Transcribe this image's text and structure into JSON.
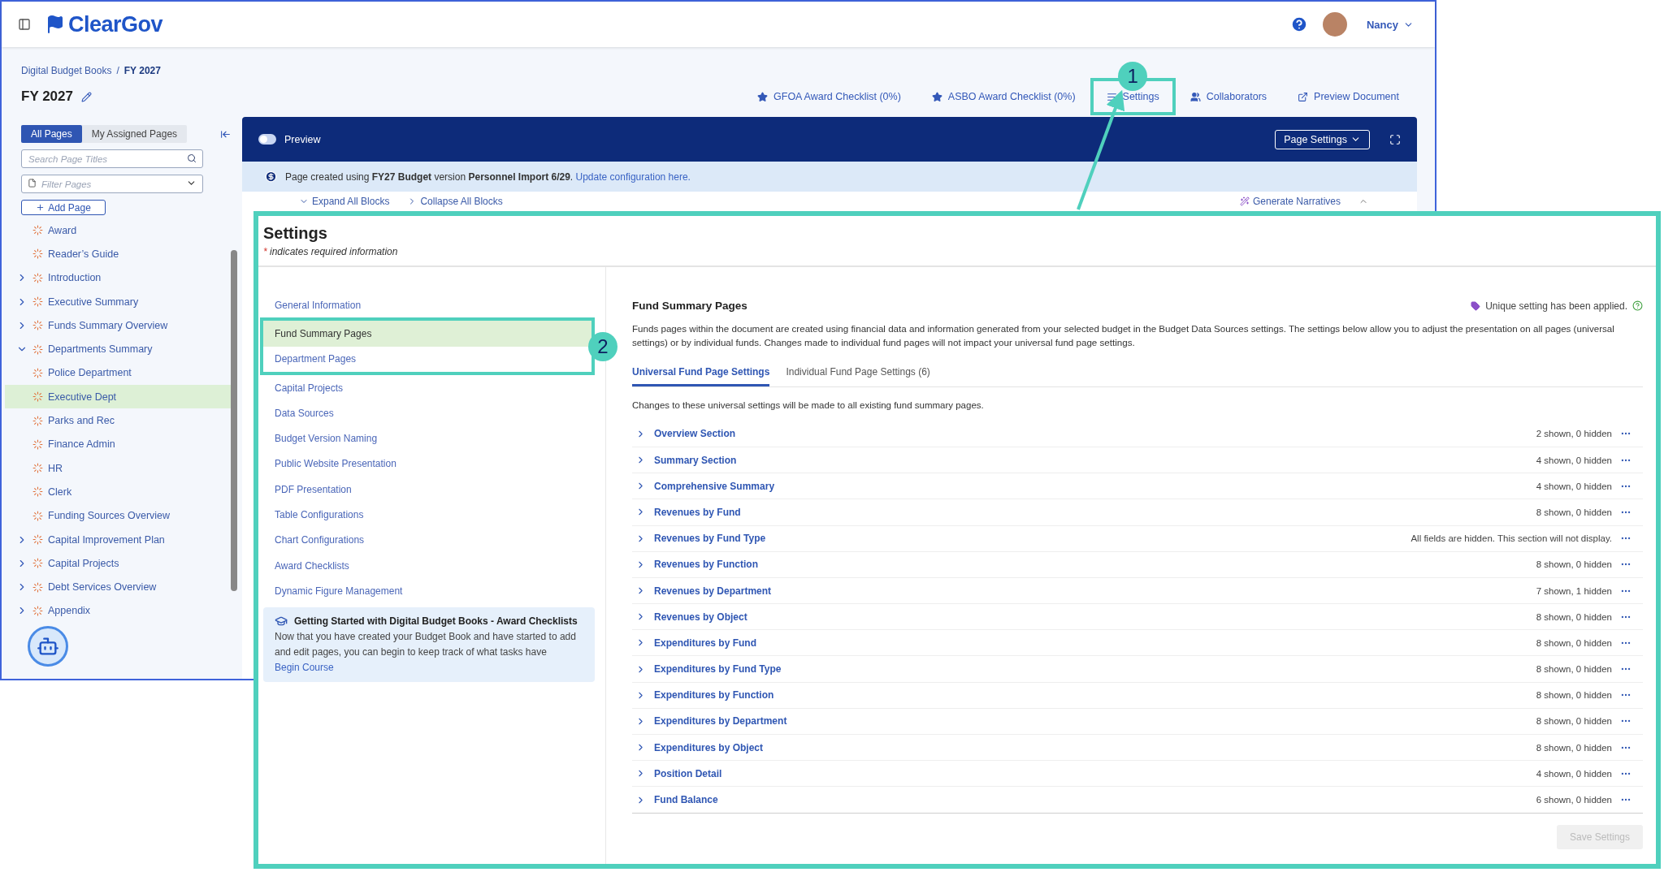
{
  "app": {
    "logo": "ClearGov",
    "user": {
      "name": "Nancy"
    },
    "breadcrumb": [
      "Digital Budget Books",
      "FY 2027"
    ],
    "breadcrumb_separator": "/",
    "title": "FY 2027",
    "actions": [
      {
        "label": "GFOA Award Checklist (0%)",
        "kind": "star"
      },
      {
        "label": "ASBO Award Checklist (0%)",
        "kind": "star"
      },
      {
        "label": "Settings",
        "kind": "settings",
        "highlighted": true
      },
      {
        "label": "Collaborators",
        "kind": "people"
      },
      {
        "label": "Preview Document",
        "kind": "external"
      }
    ],
    "sidebar": {
      "tabs": [
        {
          "label": "All Pages",
          "selected": true
        },
        {
          "label": "My Assigned Pages",
          "selected": false
        }
      ],
      "search": {
        "placeholder": "Search Page Titles"
      },
      "filter": {
        "placeholder": "Filter Pages"
      },
      "add_button": "Add Page",
      "pages": [
        {
          "label": "Award",
          "selected": false
        },
        {
          "label": "Reader’s Guide",
          "selected": false
        },
        {
          "label": "Introduction",
          "selected": false,
          "expanded": false
        },
        {
          "label": "Executive Summary",
          "selected": false,
          "expanded": false
        },
        {
          "label": "Funds Summary Overview",
          "selected": false,
          "expanded": false
        },
        {
          "label": "Departments Summary",
          "selected": false,
          "expanded": true,
          "children": [
            {
              "label": "Police Department",
              "selected": false
            },
            {
              "label": "Executive Dept",
              "selected": true
            },
            {
              "label": "Parks and Rec",
              "selected": false
            },
            {
              "label": "Finance Admin",
              "selected": false
            },
            {
              "label": "HR",
              "selected": false
            },
            {
              "label": "Clerk",
              "selected": false
            }
          ]
        },
        {
          "label": "Funding Sources Overview",
          "selected": false
        },
        {
          "label": "Capital Improvement Plan",
          "selected": false,
          "expanded": false
        },
        {
          "label": "Capital Projects",
          "selected": false,
          "expanded": false
        },
        {
          "label": "Debt Services Overview",
          "selected": false,
          "expanded": false
        },
        {
          "label": "Appendix",
          "selected": false,
          "expanded": false
        }
      ]
    },
    "editor": {
      "preview": {
        "label": "Preview",
        "on": false
      },
      "page_settings": "Page Settings",
      "info": "Page created using **FY27 Budget** version **Personnel Import 6/29**.",
      "info_link": "Update configuration here.",
      "toolbar": [
        "Expand All Blocks",
        "Collapse All Blocks",
        "Generate Narratives"
      ]
    }
  },
  "settings": {
    "title": "Settings",
    "required_mark": "*",
    "required_note": "indicates required information",
    "nav": [
      {
        "label": "General Information",
        "selected": false,
        "highlighted": false
      },
      {
        "label": "Fund Summary Pages",
        "selected": true,
        "highlighted": true
      },
      {
        "label": "Department Pages",
        "selected": false,
        "highlighted": true
      },
      {
        "label": "Capital Projects",
        "selected": false
      },
      {
        "label": "Data Sources",
        "selected": false
      },
      {
        "label": "Budget Version Naming",
        "selected": false
      },
      {
        "label": "Public Website Presentation",
        "selected": false
      },
      {
        "label": "PDF Presentation",
        "selected": false
      },
      {
        "label": "Table Configurations",
        "selected": false
      },
      {
        "label": "Chart Configurations",
        "selected": false
      },
      {
        "label": "Award Checklists",
        "selected": false
      },
      {
        "label": "Dynamic Figure Management",
        "selected": false
      }
    ],
    "course": {
      "title": "Getting Started with Digital Budget Books - Award Checklists",
      "body": "Now that you have created your Budget Book and have started to add and edit pages, you can begin to keep track of what tasks have",
      "link": "Begin Course"
    },
    "section": {
      "title": "Fund Summary Pages",
      "unique_note": "Unique setting has been applied.",
      "description": "Funds pages within the document are created using financial data and information generated from your selected budget in the Budget Data Sources settings. The settings below allow you to adjust the presentation on all pages (universal settings) or by individual funds. Changes made to individual fund pages will not impact your universal fund page settings.",
      "tabs": [
        {
          "label": "Universal Fund Page Settings",
          "selected": true
        },
        {
          "label": "Individual Fund Page Settings (6)",
          "selected": false
        }
      ],
      "tab_note": "Changes to these universal settings will be made to all existing fund summary pages.",
      "rows": [
        {
          "name": "Overview Section",
          "summary": "2 shown, 0 hidden"
        },
        {
          "name": "Summary Section",
          "summary": "4 shown, 0 hidden"
        },
        {
          "name": "Comprehensive Summary",
          "summary": "4 shown, 0 hidden"
        },
        {
          "name": "Revenues by Fund",
          "summary": "8 shown, 0 hidden"
        },
        {
          "name": "Revenues by Fund Type",
          "summary": "All fields are hidden. This section will not display."
        },
        {
          "name": "Revenues by Function",
          "summary": "8 shown, 0 hidden"
        },
        {
          "name": "Revenues by Department",
          "summary": "7 shown, 1 hidden"
        },
        {
          "name": "Revenues by Object",
          "summary": "8 shown, 0 hidden"
        },
        {
          "name": "Expenditures by Fund",
          "summary": "8 shown, 0 hidden"
        },
        {
          "name": "Expenditures by Fund Type",
          "summary": "8 shown, 0 hidden"
        },
        {
          "name": "Expenditures by Function",
          "summary": "8 shown, 0 hidden"
        },
        {
          "name": "Expenditures by Department",
          "summary": "8 shown, 0 hidden"
        },
        {
          "name": "Expenditures by Object",
          "summary": "8 shown, 0 hidden"
        },
        {
          "name": "Position Detail",
          "summary": "4 shown, 0 hidden"
        },
        {
          "name": "Fund Balance",
          "summary": "6 shown, 0 hidden"
        }
      ],
      "save_button": {
        "label": "Save Settings",
        "disabled": true
      }
    }
  },
  "callouts": [
    "1",
    "2"
  ]
}
